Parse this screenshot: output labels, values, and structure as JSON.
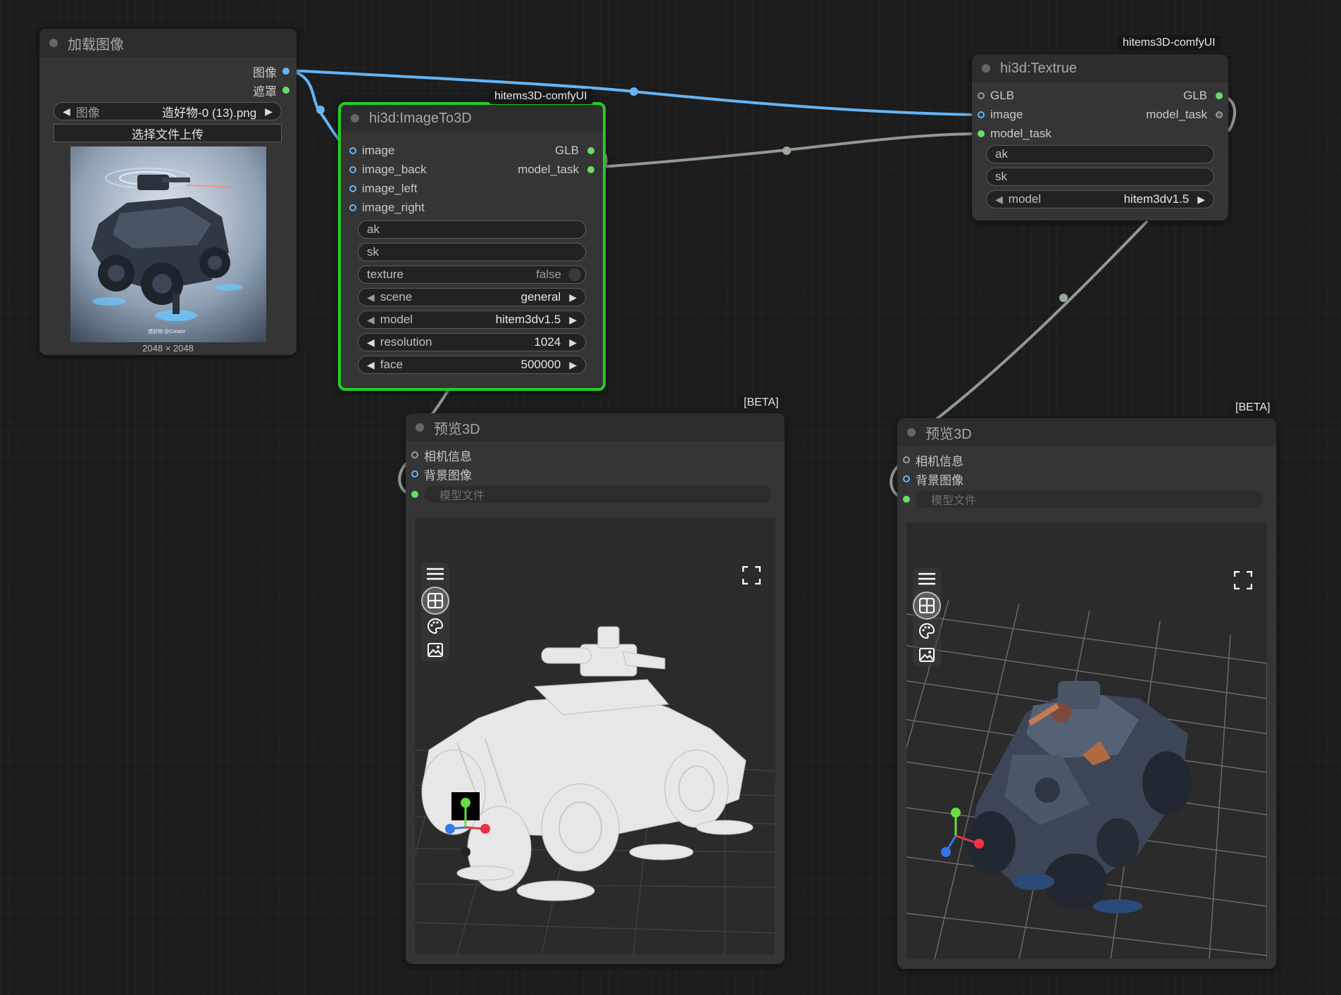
{
  "load_image_node": {
    "title": "加载图像",
    "outputs": [
      "图像",
      "遮罩"
    ],
    "image_widget": {
      "label": "图像",
      "value": "造好物-0 (13).png"
    },
    "upload_button": "选择文件上传",
    "preview_caption": "2048 × 2048",
    "watermark_text": "造好物 @Creator"
  },
  "image_to_3d_node": {
    "tag": "hitems3D-comfyUI",
    "title": "hi3d:ImageTo3D",
    "inputs": [
      "image",
      "image_back",
      "image_left",
      "image_right"
    ],
    "outputs": [
      "GLB",
      "model_task"
    ],
    "widgets": {
      "ak": "ak",
      "sk": "sk",
      "texture": {
        "label": "texture",
        "value": "false"
      },
      "scene": {
        "label": "scene",
        "value": "general"
      },
      "model": {
        "label": "model",
        "value": "hitem3dv1.5"
      },
      "resolution": {
        "label": "resolution",
        "value": "1024"
      },
      "face": {
        "label": "face",
        "value": "500000"
      }
    },
    "selected_border_color": "#22cc22"
  },
  "textrue_node": {
    "tag": "hitems3D-comfyUI",
    "title": "hi3d:Textrue",
    "inputs": [
      "GLB",
      "image",
      "model_task"
    ],
    "outputs": [
      "GLB",
      "model_task"
    ],
    "widgets": {
      "ak": "ak",
      "sk": "sk",
      "model": {
        "label": "model",
        "value": "hitem3dv1.5"
      }
    }
  },
  "preview3d_left": {
    "tag": "[BETA]",
    "title": "预览3D",
    "inputs": [
      "相机信息",
      "背景图像"
    ],
    "model_file_placeholder": "模型文件",
    "toolbar_icons": [
      "menu-icon",
      "grid-icon",
      "palette-icon",
      "image-icon"
    ],
    "fullscreen_icon": "fullscreen-icon"
  },
  "preview3d_right": {
    "tag": "[BETA]",
    "title": "预览3D",
    "inputs": [
      "相机信息",
      "背景图像"
    ],
    "model_file_placeholder": "模型文件",
    "toolbar_icons": [
      "menu-icon",
      "grid-icon",
      "palette-icon",
      "image-icon"
    ],
    "fullscreen_icon": "fullscreen-icon"
  },
  "colors": {
    "canvas": "#1c1c1c",
    "node": "#353535",
    "image_wire": "#64b5f6",
    "model_wire": "#9aa89a",
    "green_slot": "#66dd66"
  }
}
